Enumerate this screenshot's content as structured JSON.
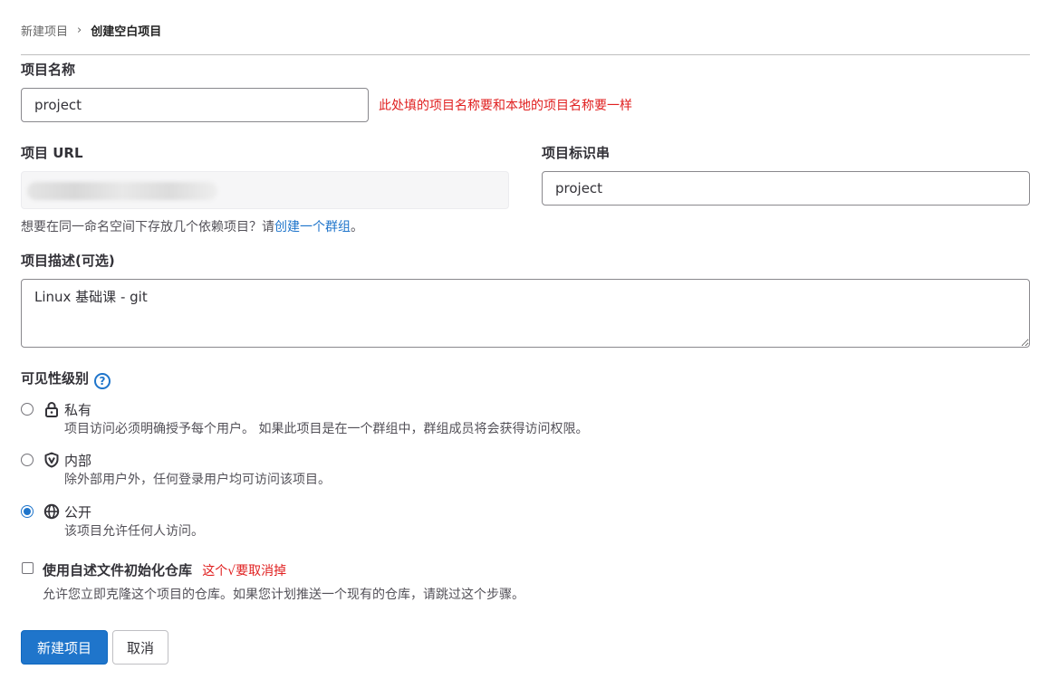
{
  "breadcrumb": {
    "parent": "新建项目",
    "separator": "›",
    "current": "创建空白项目"
  },
  "project_name": {
    "label": "项目名称",
    "value": "project",
    "annotation": "此处填的项目名称要和本地的项目名称要一样"
  },
  "project_url": {
    "label": "项目 URL"
  },
  "project_slug": {
    "label": "项目标识串",
    "value": "project"
  },
  "namespace_help": {
    "text": "想要在同一命名空间下存放几个依赖项目？请",
    "link": "创建一个群组",
    "suffix": "。"
  },
  "description": {
    "label": "项目描述(可选)",
    "value": "Linux 基础课 - git"
  },
  "visibility": {
    "label": "可见性级别",
    "help_icon": "question-circle-icon",
    "options": [
      {
        "key": "private",
        "icon": "lock-icon",
        "title": "私有",
        "desc": "项目访问必须明确授予每个用户。 如果此项目是在一个群组中，群组成员将会获得访问权限。",
        "checked": false
      },
      {
        "key": "internal",
        "icon": "shield-icon",
        "title": "内部",
        "desc": "除外部用户外，任何登录用户均可访问该项目。",
        "checked": false
      },
      {
        "key": "public",
        "icon": "globe-icon",
        "title": "公开",
        "desc": "该项目允许任何人访问。",
        "checked": true
      }
    ]
  },
  "readme": {
    "label": "使用自述文件初始化仓库",
    "annotation": "这个√要取消掉",
    "desc": "允许您立即克隆这个项目的仓库。如果您计划推送一个现有的仓库，请跳过这个步骤。",
    "checked": false
  },
  "actions": {
    "create_label": "新建项目",
    "cancel_label": "取消"
  },
  "colors": {
    "primary": "#1f75cb",
    "annotation_red": "#e02020"
  }
}
